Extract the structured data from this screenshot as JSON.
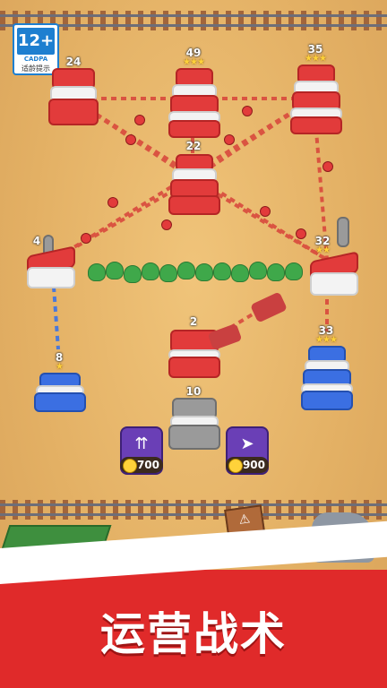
{
  "age_rating": {
    "number": "12+",
    "label": "CADPA",
    "tip": "适龄提示"
  },
  "towers": {
    "top_left": {
      "level": "24"
    },
    "top_center": {
      "level": "49"
    },
    "top_right": {
      "level": "35"
    },
    "middle": {
      "level": "22"
    },
    "factory_left": {
      "level": "4"
    },
    "factory_right": {
      "level": "32"
    },
    "blue_left": {
      "level": "8"
    },
    "red_center": {
      "level": "2"
    },
    "gray_center": {
      "level": "10"
    },
    "blue_right": {
      "level": "33"
    }
  },
  "cards": {
    "rockets": {
      "price": "700",
      "icon": "rocket-icon"
    },
    "speed": {
      "price": "900",
      "icon": "running-man-icon"
    }
  },
  "banner": {
    "title": "运营战术"
  },
  "colors": {
    "red_team": "#e23b3b",
    "blue_team": "#3b6fe2",
    "neutral": "#9a9a9a",
    "banner": "#e02a2a"
  }
}
